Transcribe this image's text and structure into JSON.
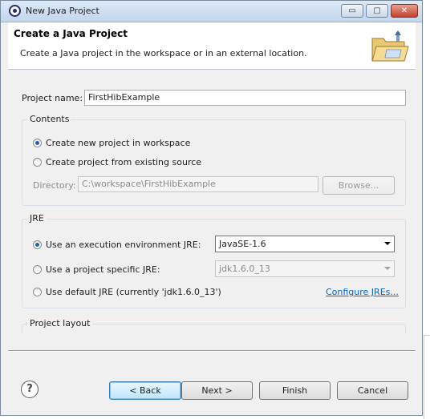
{
  "window": {
    "title": "New Java Project",
    "controls": {
      "minimize": "▭",
      "maximize": "▢",
      "close": "✕"
    }
  },
  "header": {
    "title": "Create a Java Project",
    "description": "Create a Java project in the workspace or in an external location.",
    "icon": "folder-wizard-icon"
  },
  "project": {
    "name_label": "Project name:",
    "name_value": "FirstHibExample"
  },
  "contents": {
    "legend": "Contents",
    "options": [
      {
        "label": "Create new project in workspace",
        "checked": true
      },
      {
        "label": "Create project from existing source",
        "checked": false
      }
    ],
    "directory_label": "Directory:",
    "directory_value": "C:\\workspace\\FirstHibExample",
    "browse_label": "Browse..."
  },
  "jre": {
    "legend": "JRE",
    "options": [
      {
        "label": "Use an execution environment JRE:",
        "checked": true,
        "select": "JavaSE-1.6"
      },
      {
        "label": "Use a project specific JRE:",
        "checked": false,
        "select": "jdk1.6.0_13"
      },
      {
        "label": "Use default JRE (currently 'jdk1.6.0_13')",
        "checked": false
      }
    ],
    "configure_link": "Configure JREs..."
  },
  "project_layout": {
    "legend": "Project layout"
  },
  "footer": {
    "help_icon": "?",
    "back": "< Back",
    "next": "Next >",
    "finish": "Finish",
    "cancel": "Cancel"
  },
  "colors": {
    "link": "#0066cc",
    "default_button_border": "#3c7fb1",
    "close_button": "#c0412c"
  }
}
